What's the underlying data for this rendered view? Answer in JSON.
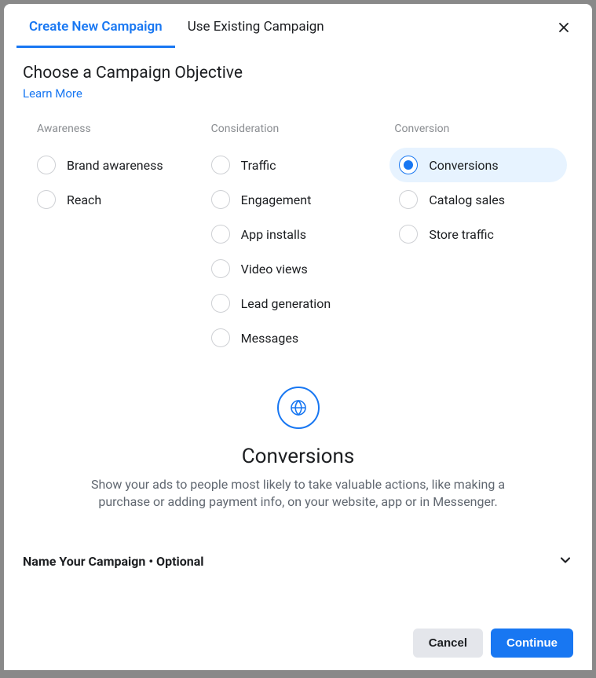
{
  "tabs": {
    "create": "Create New Campaign",
    "existing": "Use Existing Campaign"
  },
  "heading": "Choose a Campaign Objective",
  "learn_more": "Learn More",
  "columns": {
    "awareness": {
      "title": "Awareness",
      "items": {
        "brand_awareness": "Brand awareness",
        "reach": "Reach"
      }
    },
    "consideration": {
      "title": "Consideration",
      "items": {
        "traffic": "Traffic",
        "engagement": "Engagement",
        "app_installs": "App installs",
        "video_views": "Video views",
        "lead_generation": "Lead generation",
        "messages": "Messages"
      }
    },
    "conversion": {
      "title": "Conversion",
      "items": {
        "conversions": "Conversions",
        "catalog_sales": "Catalog sales",
        "store_traffic": "Store traffic"
      }
    }
  },
  "selected_objective": "conversions",
  "detail": {
    "title": "Conversions",
    "description": "Show your ads to people most likely to take valuable actions, like making a purchase or adding payment info, on your website, app or in Messenger."
  },
  "name_campaign_label": "Name Your Campaign • Optional",
  "footer": {
    "cancel": "Cancel",
    "continue": "Continue"
  }
}
